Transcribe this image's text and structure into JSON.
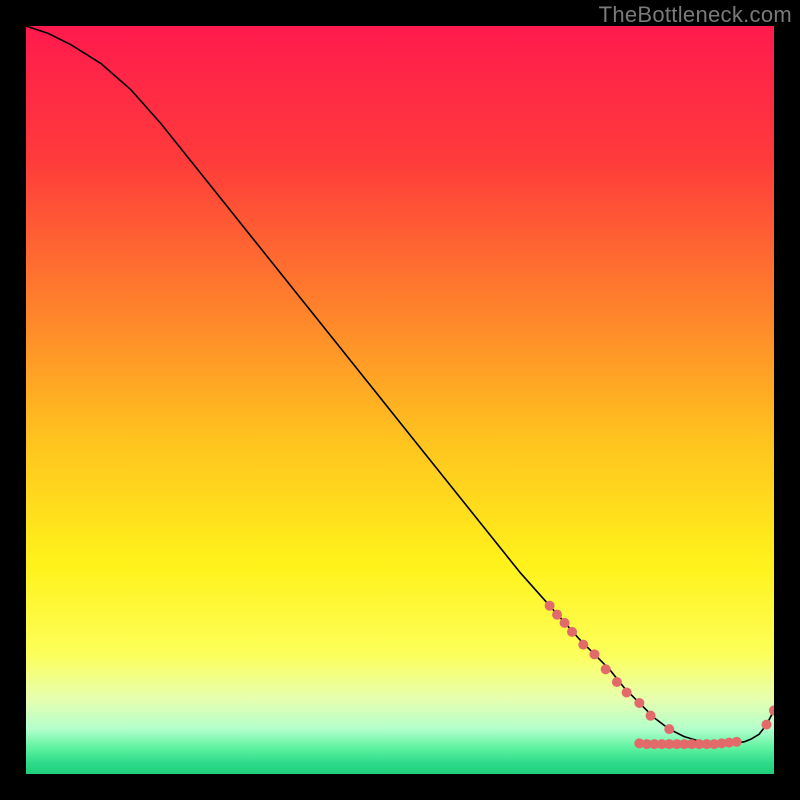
{
  "watermark": "TheBottleneck.com",
  "chart_data": {
    "type": "line",
    "title": "",
    "xlabel": "",
    "ylabel": "",
    "xlim": [
      0,
      100
    ],
    "ylim": [
      0,
      100
    ],
    "background_gradient": {
      "orientation": "vertical",
      "stops": [
        {
          "pos": 0.0,
          "color": "#ff1a4d"
        },
        {
          "pos": 0.18,
          "color": "#ff3b3b"
        },
        {
          "pos": 0.4,
          "color": "#ff8a2a"
        },
        {
          "pos": 0.55,
          "color": "#ffc21f"
        },
        {
          "pos": 0.72,
          "color": "#fff21a"
        },
        {
          "pos": 0.84,
          "color": "#fdff5a"
        },
        {
          "pos": 0.9,
          "color": "#e6ffb0"
        },
        {
          "pos": 0.94,
          "color": "#b3ffcc"
        },
        {
          "pos": 0.965,
          "color": "#5ef2a0"
        },
        {
          "pos": 0.985,
          "color": "#2edb8a"
        },
        {
          "pos": 1.0,
          "color": "#1fcf7a"
        }
      ]
    },
    "series": [
      {
        "name": "bottleneck-percentage",
        "color": "#000000",
        "width": 1.6,
        "x": [
          0,
          3,
          6,
          10,
          14,
          18,
          22,
          26,
          30,
          34,
          38,
          42,
          46,
          50,
          54,
          58,
          62,
          66,
          70,
          74,
          78,
          80,
          82,
          84,
          86,
          88,
          90,
          92,
          94,
          96,
          97,
          98,
          99,
          100
        ],
        "y": [
          100,
          99,
          97.5,
          95,
          91.5,
          87,
          82,
          77,
          72,
          67,
          62,
          57,
          52,
          47,
          42,
          37,
          32,
          27,
          22.5,
          18,
          14,
          11.5,
          9.5,
          7.5,
          6,
          5,
          4.4,
          4,
          4,
          4.3,
          4.7,
          5.3,
          6.6,
          8.5
        ]
      }
    ],
    "markers": {
      "color": "#e26a6a",
      "radius": 5,
      "points": [
        {
          "x": 70,
          "y": 22.5
        },
        {
          "x": 71,
          "y": 21.3
        },
        {
          "x": 72,
          "y": 20.2
        },
        {
          "x": 73,
          "y": 19.0
        },
        {
          "x": 74.5,
          "y": 17.3
        },
        {
          "x": 76,
          "y": 16
        },
        {
          "x": 77.5,
          "y": 14
        },
        {
          "x": 79,
          "y": 12.3
        },
        {
          "x": 80.3,
          "y": 10.9
        },
        {
          "x": 82,
          "y": 9.5
        },
        {
          "x": 83.5,
          "y": 7.8
        },
        {
          "x": 86,
          "y": 6
        },
        {
          "x": 82,
          "y": 4.1
        },
        {
          "x": 83,
          "y": 4.0
        },
        {
          "x": 84,
          "y": 4.0
        },
        {
          "x": 85,
          "y": 4.0
        },
        {
          "x": 86,
          "y": 4.0
        },
        {
          "x": 87,
          "y": 4.0
        },
        {
          "x": 88,
          "y": 4.0
        },
        {
          "x": 89,
          "y": 4.0
        },
        {
          "x": 90,
          "y": 4.0
        },
        {
          "x": 91,
          "y": 4.0
        },
        {
          "x": 92,
          "y": 4.0
        },
        {
          "x": 93,
          "y": 4.1
        },
        {
          "x": 94,
          "y": 4.2
        },
        {
          "x": 95,
          "y": 4.3
        },
        {
          "x": 99,
          "y": 6.6
        },
        {
          "x": 100,
          "y": 8.5
        }
      ]
    }
  }
}
